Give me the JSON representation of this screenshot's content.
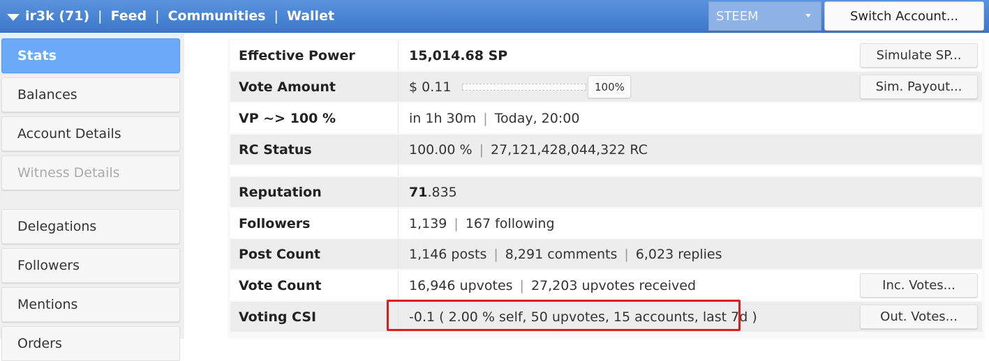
{
  "nav": {
    "account": "ir3k (71)",
    "feed": "Feed",
    "communities": "Communities",
    "wallet": "Wallet",
    "separator": "|"
  },
  "chain_select": {
    "selected": "STEEM"
  },
  "switch_account_label": "Switch Account...",
  "sidebar": {
    "items": [
      {
        "label": "Stats",
        "state": "active"
      },
      {
        "label": "Balances"
      },
      {
        "label": "Account Details"
      },
      {
        "label": "Witness Details",
        "state": "disabled"
      },
      {
        "label": "Delegations"
      },
      {
        "label": "Followers"
      },
      {
        "label": "Mentions"
      },
      {
        "label": "Orders"
      }
    ]
  },
  "stats": {
    "effective_power": {
      "label": "Effective Power",
      "value": "15,014.68 SP",
      "button": "Simulate SP..."
    },
    "vote_amount": {
      "label": "Vote Amount",
      "value": "$ 0.11",
      "percent": "100%",
      "button": "Sim. Payout..."
    },
    "vp": {
      "label": "VP ~> 100 %",
      "eta": "in 1h 30m",
      "time": "Today, 20:00"
    },
    "rc_status": {
      "label": "RC Status",
      "percent": "100.00 %",
      "rc": "27,121,428,044,322 RC"
    },
    "reputation": {
      "label": "Reputation",
      "int": "71",
      "frac": ".835"
    },
    "followers": {
      "label": "Followers",
      "followers": "1,139",
      "following": "167 following"
    },
    "post_count": {
      "label": "Post Count",
      "posts": "1,146 posts",
      "comments": "8,291 comments",
      "replies": "6,023 replies"
    },
    "vote_count": {
      "label": "Vote Count",
      "upvotes": "16,946 upvotes",
      "received": "27,203 upvotes received",
      "button": "Inc. Votes..."
    },
    "voting_csi": {
      "label": "Voting CSI",
      "value": "-0.1 ( 2.00 % self, 50 upvotes, 15 accounts, last 7d )",
      "button": "Out. Votes..."
    }
  },
  "colors": {
    "topbar": "#4a86d6",
    "active_tab": "#6aaaf6",
    "highlight": "#e01b1b"
  }
}
